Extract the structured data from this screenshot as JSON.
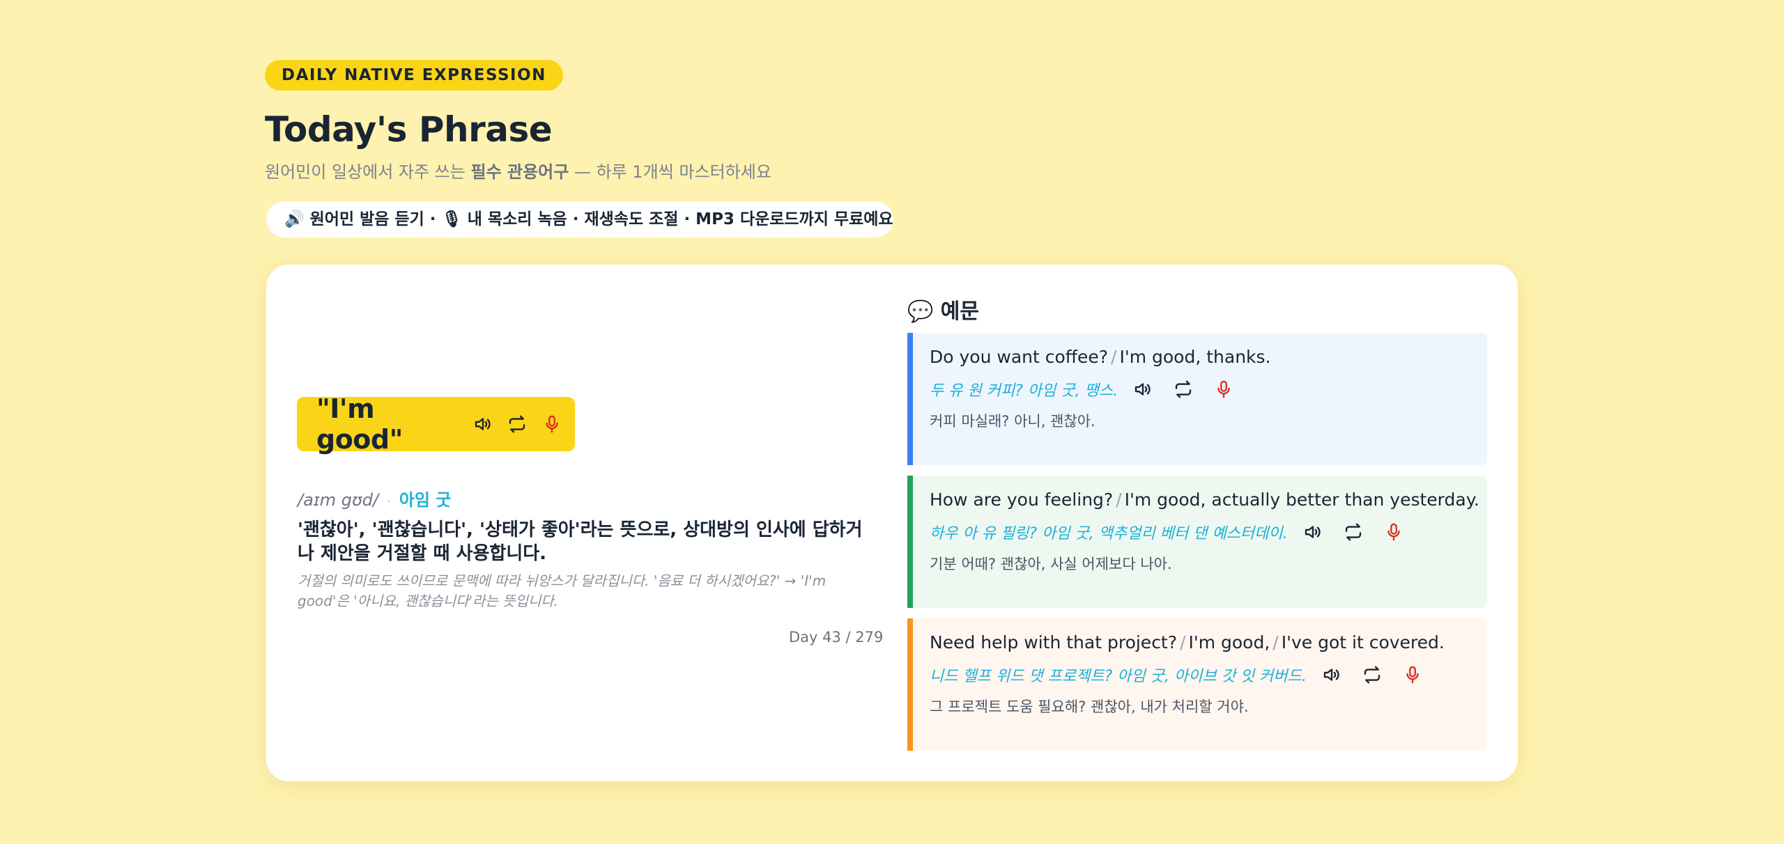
{
  "header": {
    "badge": "DAILY NATIVE EXPRESSION",
    "title": "Today's Phrase",
    "subtitle_pre": "원어민이 일상에서 자주 쓰는 ",
    "subtitle_bold": "필수 관용어구",
    "subtitle_post": " — 하루 1개씩 마스터하세요"
  },
  "features": {
    "icon": "speaker-emoji",
    "text": "🔊 원어민 발음 듣기 · 🎙 내 목소리 녹음 · 재생속도 조절 · MP3 다운로드까지 무료예요"
  },
  "phrase": {
    "text": "\"I'm good\"",
    "ipa": "/aɪm gʊd/",
    "separator": "·",
    "korean_pron": "아임 굿",
    "meaning": "'괜찮아', '괜찮습니다', '상태가 좋아'라는 뜻으로, 상대방의 인사에 답하거나 제안을 거절할 때 사용합니다.",
    "note": "거절의 의미로도 쓰이므로 문맥에 따라 뉘앙스가 달라집니다. '음료 더 하시겠어요?' → 'I'm good'은 '아니요, 괜찮습니다'라는 뜻입니다.",
    "day": "Day 43 / 279"
  },
  "examples": {
    "heading_icon": "speech-bubble-emoji",
    "heading": "💬 예문",
    "items": [
      {
        "en_a": "Do you want coffee?",
        "en_b": "I'm good, thanks.",
        "pron": "두 유 원 커피? 아임 굿, 땡스.",
        "ko": "커피 마실래? 아니, 괜찮아.",
        "accent": "#3b82f6",
        "bg": "#eef5ff"
      },
      {
        "en_a": "How are you feeling?",
        "en_b": "I'm good, actually better than yesterday.",
        "pron": "하우 아 유 필링? 아임 굿, 액추얼리 베터 댄 예스터데이.",
        "ko": "기분 어때? 괜찮아, 사실 어제보다 나아.",
        "accent": "#22a35a",
        "bg": "#eef8f1"
      },
      {
        "en_a": "Need help with that project?",
        "en_b": "I'm good,",
        "en_c": "I've got it covered.",
        "pron": "니드 헬프 위드 댓 프로젝트? 아임 굿, 아이브 갓 잇 커버드.",
        "ko": "그 프로젝트 도움 필요해? 괜찮아, 내가 처리할 거야.",
        "accent": "#f7941d",
        "bg": "#fff6ef"
      }
    ]
  },
  "colors": {
    "page_bg": "#fef2b0",
    "brand_yellow": "#fad416",
    "pron_cyan": "#1ab0d8",
    "mic_red": "#d93025"
  }
}
